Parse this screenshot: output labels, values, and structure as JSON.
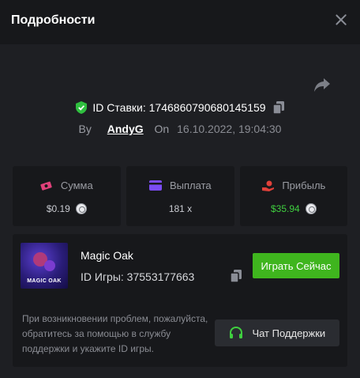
{
  "header": {
    "title": "Подробности"
  },
  "bet": {
    "id_label": "ID Ставки:",
    "id_value": "1746860790680145159",
    "by_label": "By",
    "username": "AndyG",
    "on_label": "On",
    "date": "16.10.2022, 19:04:30"
  },
  "stats": [
    {
      "title": "Сумма",
      "value": "$0.19",
      "icon": "cash-icon",
      "color": "#e0417a"
    },
    {
      "title": "Выплата",
      "value": "181 x",
      "icon": "card-icon",
      "color": "#7b4cf5"
    },
    {
      "title": "Прибыль",
      "value": "$35.94",
      "icon": "hand-coin-icon",
      "color": "#e0413a"
    }
  ],
  "game": {
    "name": "Magic Oak",
    "id_label": "ID Игры:",
    "id_value": "37553177663",
    "id_text": "ID Игры: 37553177663",
    "play_label": "Играть Сейчас",
    "thumb_logo": "MAGIC OAK"
  },
  "support": {
    "help_text": "При возникновении проблем, пожалуйста, обратитесь за помощью в службу поддержки и укажите ID игры.",
    "button_label": "Чат Поддержки"
  },
  "colors": {
    "accent_green": "#3fb51e",
    "profit_green": "#3fcf3f",
    "verified_green": "#2fbf3f"
  }
}
